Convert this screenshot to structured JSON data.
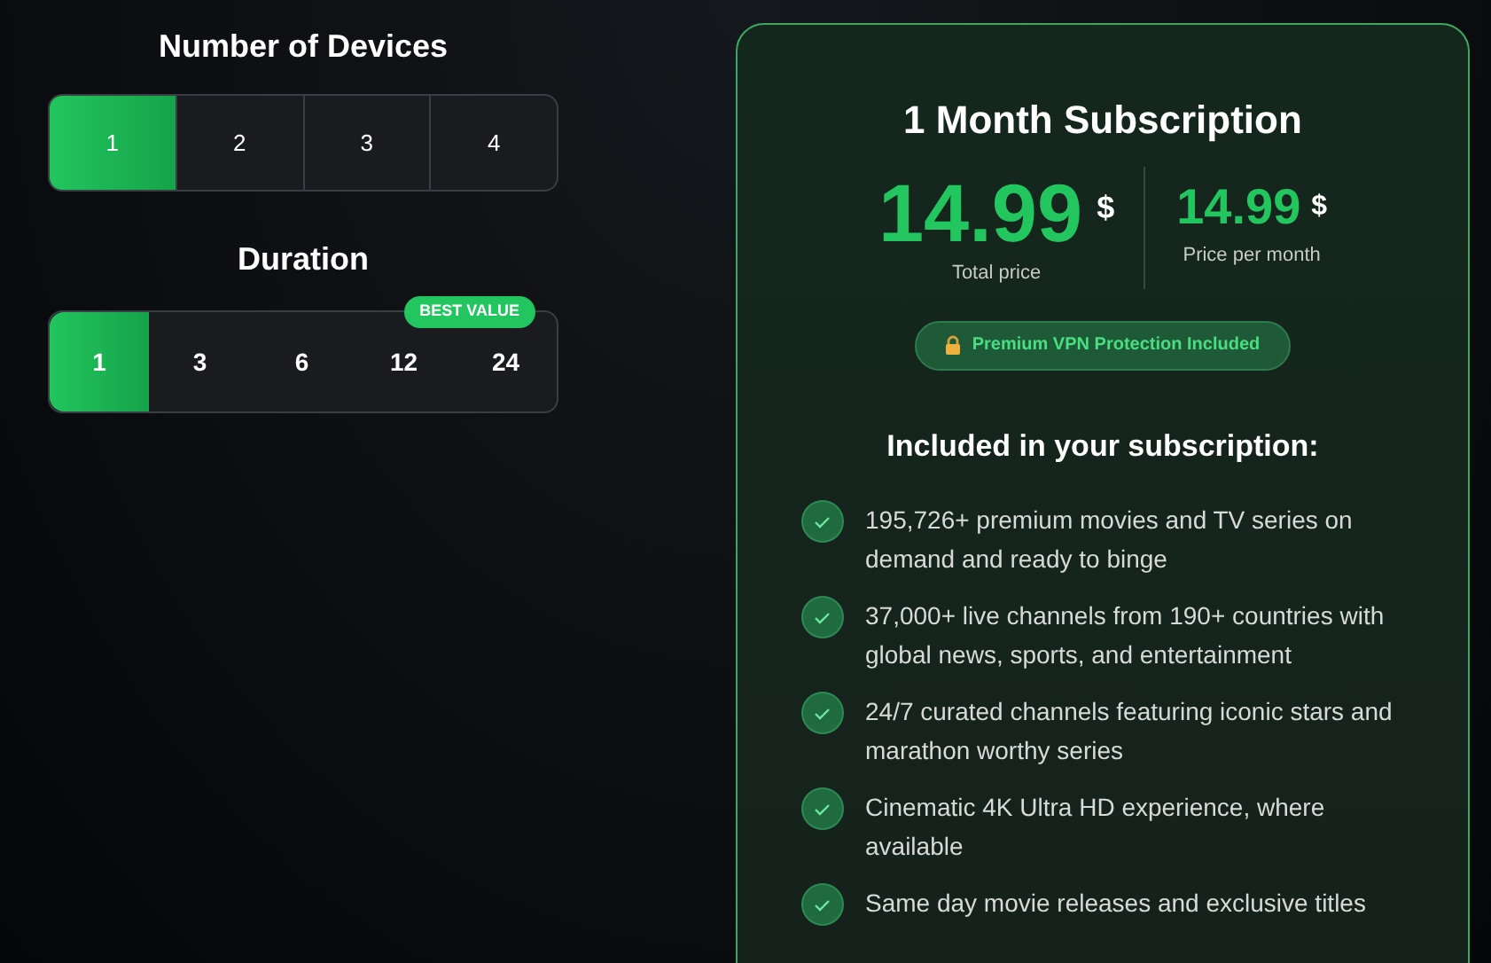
{
  "devices": {
    "title": "Number of Devices",
    "options": [
      {
        "label": "1",
        "selected": true
      },
      {
        "label": "2",
        "selected": false
      },
      {
        "label": "3",
        "selected": false
      },
      {
        "label": "4",
        "selected": false
      }
    ]
  },
  "duration": {
    "title": "Duration",
    "badge": "BEST VALUE",
    "options": [
      {
        "label": "1",
        "selected": true
      },
      {
        "label": "3",
        "selected": false
      },
      {
        "label": "6",
        "selected": false
      },
      {
        "label": "12",
        "selected": false
      },
      {
        "label": "24",
        "selected": false
      }
    ]
  },
  "plan": {
    "title": "1 Month Subscription",
    "total_price": "14.99",
    "total_currency": "$",
    "total_label": "Total price",
    "monthly_price": "14.99",
    "monthly_currency": "$",
    "monthly_label": "Price per month",
    "vpn_badge": "Premium VPN Protection Included",
    "included_heading": "Included in your subscription:",
    "features": [
      "195,726+ premium movies and TV series on demand and ready to binge",
      "37,000+ live channels from 190+ countries with global news, sports, and entertainment",
      "24/7 curated channels featuring iconic stars and marathon worthy series",
      "Cinematic 4K Ultra HD experience, where available",
      "Same day movie releases and exclusive titles"
    ]
  }
}
